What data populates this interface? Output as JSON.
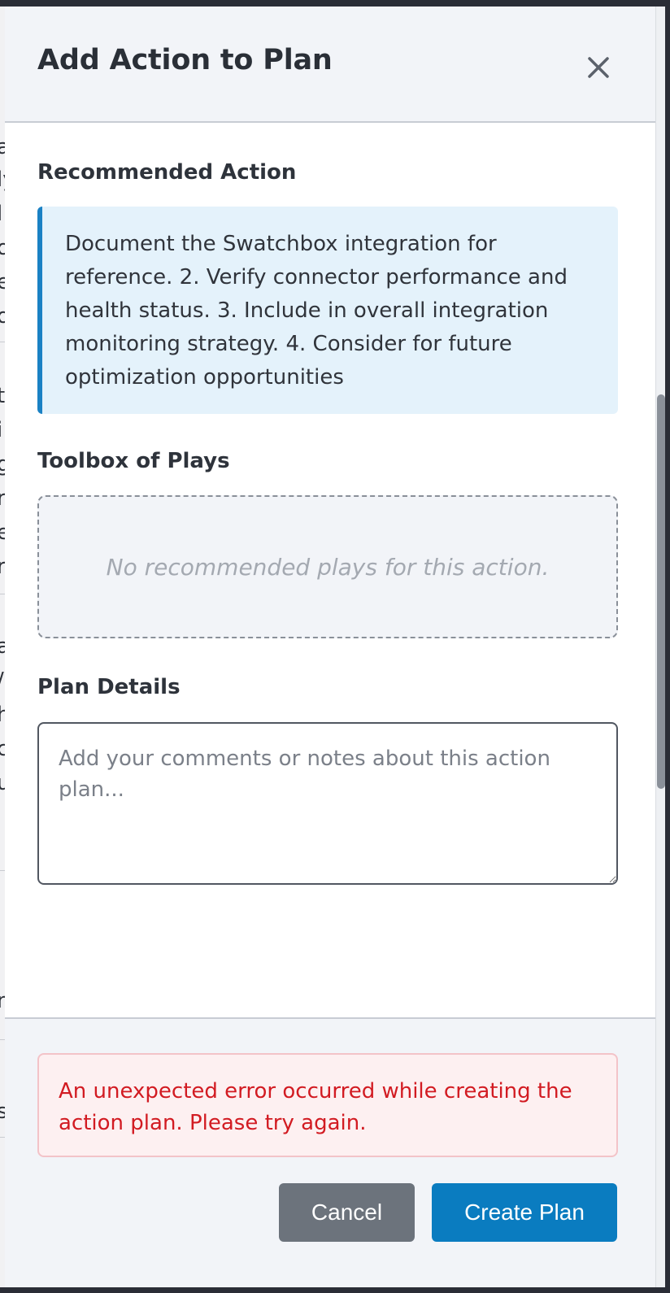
{
  "modal": {
    "title": "Add Action to Plan",
    "close_icon": "close-icon"
  },
  "recommended_action": {
    "label": "Recommended Action",
    "text": "Document the Swatchbox integration for reference. 2. Verify connector performance and health status. 3. Include in overall integration monitoring strategy. 4. Consider for future optimization opportunities"
  },
  "toolbox": {
    "label": "Toolbox of Plays",
    "empty_text": "No recommended plays for this action."
  },
  "plan_details": {
    "label": "Plan Details",
    "placeholder": "Add your comments or notes about this action plan...",
    "value": ""
  },
  "error": {
    "message": "An unexpected error occurred while creating the action plan. Please try again."
  },
  "footer": {
    "cancel_label": "Cancel",
    "create_label": "Create Plan"
  },
  "background_fragments": [
    "a",
    "ly",
    "l",
    "o",
    "e",
    "o",
    "t",
    "i",
    "g",
    "r",
    "e",
    "r",
    "a",
    "/",
    "h",
    "c",
    "u",
    "n",
    "s"
  ],
  "colors": {
    "accent": "#0a7cc0",
    "info_bg": "#e4f2fb",
    "info_border": "#1a81c4",
    "error_text": "#d21b22",
    "error_bg": "#fdf0f1",
    "cancel_bg": "#6c737c"
  }
}
